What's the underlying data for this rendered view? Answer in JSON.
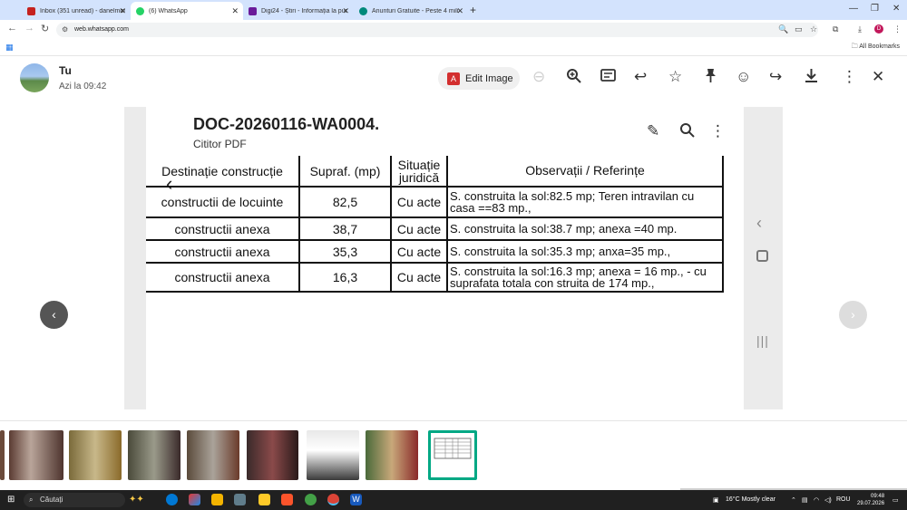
{
  "browser": {
    "tabs": [
      {
        "label": "Inbox (351 unread) - danelmon",
        "favicon_color": "#c5221f"
      },
      {
        "label": "(6) WhatsApp",
        "favicon_color": "#25d366"
      },
      {
        "label": "Digi24 - Știri - Informația la pur",
        "favicon_color": "#6a1b9a"
      },
      {
        "label": "Anunturi Gratuite - Peste 4 mili",
        "favicon_color": "#00897b"
      }
    ],
    "url": "web.whatsapp.com",
    "all_bookmarks": "All Bookmarks",
    "profile_initial": "D"
  },
  "viewer": {
    "sender": "Tu",
    "time": "Azi la 09:42",
    "edit_image_label": "Edit Image"
  },
  "document": {
    "title": "DOC-20260116-WA0004.",
    "subtitle": "Cititor PDF",
    "table": {
      "headers": [
        "Destinație construcție",
        "Supraf. (mp)",
        "Situație juridică",
        "Observații / Referințe"
      ],
      "rows": [
        [
          "constructii de locuinte",
          "82,5",
          "Cu acte",
          "S. construita la sol:82.5 mp;  Teren intravilan cu casa ==83 mp.,"
        ],
        [
          "constructii anexa",
          "38,7",
          "Cu acte",
          "S. construita la sol:38.7 mp;  anexa =40 mp."
        ],
        [
          "constructii anexa",
          "35,3",
          "Cu acte",
          "S. construita la sol:35.3 mp;  anxa=35 mp.,"
        ],
        [
          "constructii anexa",
          "16,3",
          "Cu acte",
          "S. construita la sol:16.3 mp;  anexa = 16 mp., - cu suprafata totala con struita de 174 mp.,"
        ]
      ]
    }
  },
  "taskbar": {
    "search_placeholder": "Căutați",
    "weather": "16°C  Mostly clear",
    "language": "ROU",
    "time": "09:48",
    "date": "29.07.2026"
  }
}
